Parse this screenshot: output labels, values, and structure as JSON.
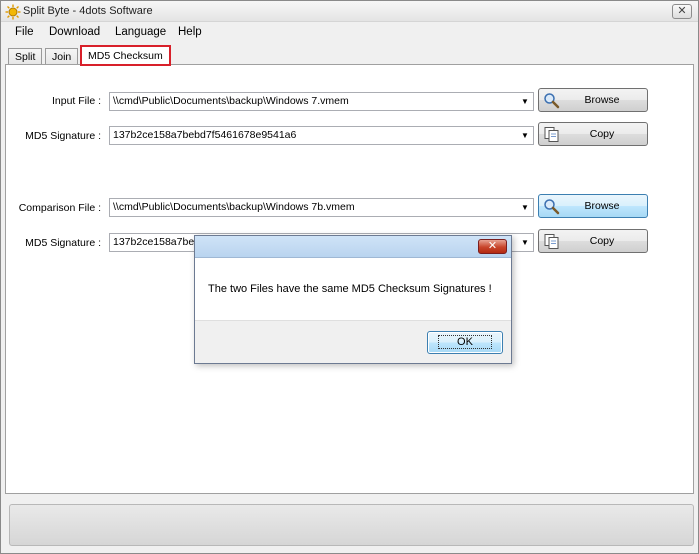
{
  "window": {
    "title": "Split Byte - 4dots Software",
    "close_glyph": "✕"
  },
  "menu": [
    {
      "label": "File"
    },
    {
      "label": "Download"
    },
    {
      "label": "Language"
    },
    {
      "label": "Help"
    }
  ],
  "tabs": [
    {
      "label": "Split"
    },
    {
      "label": "Join"
    },
    {
      "label": "MD5 Checksum"
    }
  ],
  "form": {
    "input_file_label": "Input File :",
    "input_file_value": "\\\\cmd\\Public\\Documents\\backup\\Windows 7.vmem",
    "md5_label_1": "MD5 Signature :",
    "md5_value_1": "137b2ce158a7bebd7f5461678e9541a6",
    "comparison_file_label": "Comparison File :",
    "comparison_file_value": "\\\\cmd\\Public\\Documents\\backup\\Windows 7b.vmem",
    "md5_label_2": "MD5 Signature :",
    "md5_value_2": "137b2ce158a7bebd",
    "browse_label": "Browse",
    "copy_label": "Copy",
    "arrow_glyph": "▼"
  },
  "dialog": {
    "message": "The two Files have the same MD5 Checksum Signatures !",
    "ok_label": "OK",
    "close_glyph": "✕"
  },
  "colors": {
    "active_tab_border": "#d8202a",
    "dialog_title": "#b9d4ef"
  }
}
